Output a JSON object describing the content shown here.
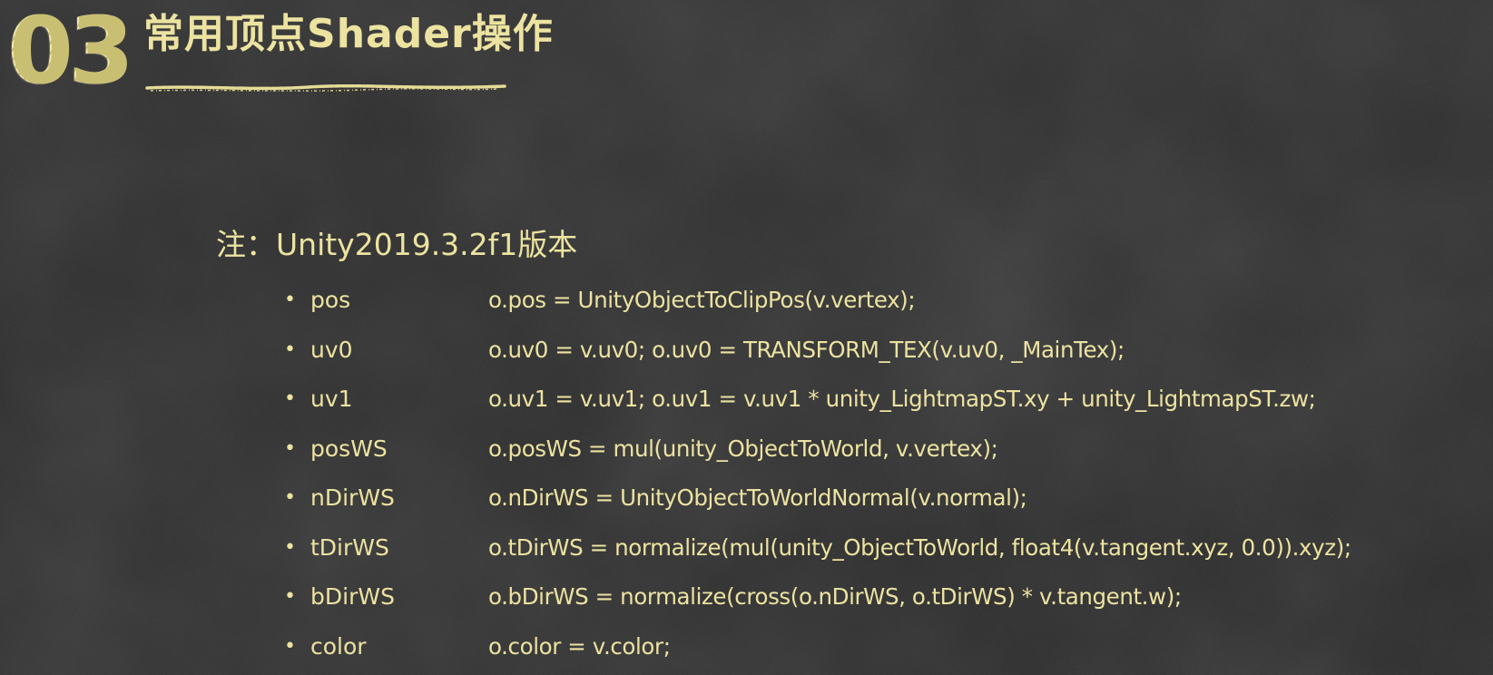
{
  "header": {
    "number": "03",
    "title": "常用顶点Shader操作"
  },
  "note": {
    "title": "注：Unity2019.3.2f1版本"
  },
  "items": [
    {
      "name": "pos",
      "code": "o.pos = UnityObjectToClipPos(v.vertex);"
    },
    {
      "name": "uv0",
      "code": "o.uv0 = v.uv0;   o.uv0 = TRANSFORM_TEX(v.uv0, _MainTex);"
    },
    {
      "name": "uv1",
      "code": "o.uv1 = v.uv1;   o.uv1 = v.uv1 * unity_LightmapST.xy + unity_LightmapST.zw;"
    },
    {
      "name": "posWS",
      "code": "o.posWS = mul(unity_ObjectToWorld, v.vertex);"
    },
    {
      "name": "nDirWS",
      "code": "o.nDirWS = UnityObjectToWorldNormal(v.normal);"
    },
    {
      "name": "tDirWS",
      "code": "o.tDirWS = normalize(mul(unity_ObjectToWorld, float4(v.tangent.xyz, 0.0)).xyz);"
    },
    {
      "name": "bDirWS",
      "code": "o.bDirWS = normalize(cross(o.nDirWS, o.tDirWS) * v.tangent.w);"
    },
    {
      "name": "color",
      "code": "o.color = v.color;"
    }
  ],
  "colors": {
    "chalk_yellow": "#ece3a1",
    "board": "#2b2b2b"
  }
}
